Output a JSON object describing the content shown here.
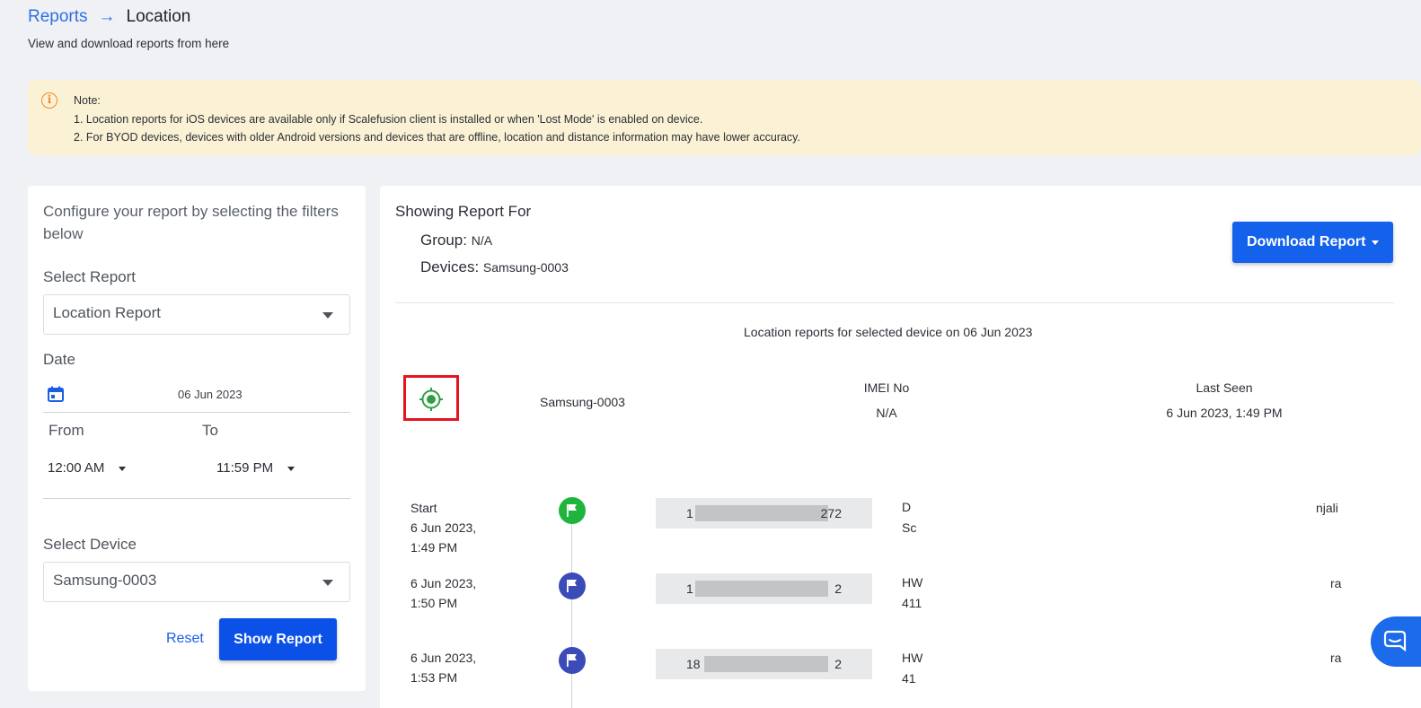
{
  "breadcrumb": {
    "parent": "Reports",
    "current": "Location"
  },
  "subtitle": "View and download reports from here",
  "note": {
    "title": "Note:",
    "line1": "1. Location reports for iOS devices are available only if Scalefusion client is installed or when 'Lost Mode' is enabled on device.",
    "line2": "2. For BYOD devices, devices with older Android versions and devices that are offline, location and distance information may have lower accuracy."
  },
  "filters": {
    "intro": "Configure your report by selecting the filters below",
    "select_report_label": "Select Report",
    "select_report_value": "Location Report",
    "date_label": "Date",
    "date_value": "06 Jun 2023",
    "from_label": "From",
    "to_label": "To",
    "from_value": "12:00 AM",
    "to_value": "11:59 PM",
    "select_device_label": "Select Device",
    "select_device_value": "Samsung-0003",
    "reset_label": "Reset",
    "show_label": "Show Report"
  },
  "report": {
    "showing_title": "Showing Report For",
    "group_label": "Group:",
    "group_value": "N/A",
    "devices_label": "Devices:",
    "devices_value": "Samsung-0003",
    "download_label": "Download Report",
    "caption": "Location reports for selected device on 06 Jun 2023",
    "device_name": "Samsung-0003",
    "imei_label": "IMEI No",
    "imei_value": "N/A",
    "last_seen_label": "Last Seen",
    "last_seen_value": "6 Jun 2023, 1:49 PM"
  },
  "timeline": [
    {
      "label": "Start",
      "date": "6 Jun 2023,",
      "time": "1:49 PM",
      "coord_start": "1",
      "coord_end": "272",
      "addr1": "D",
      "addr2": "Sc",
      "addr_end": "njali",
      "dot_color": "#1fb53d"
    },
    {
      "label": "",
      "date": "6 Jun 2023,",
      "time": "1:50 PM",
      "coord_start": "1",
      "coord_end": "2",
      "addr1": "HW",
      "addr2": "411",
      "addr_end": "ra",
      "dot_color": "#3b4bb8"
    },
    {
      "label": "",
      "date": "6 Jun 2023,",
      "time": "1:53 PM",
      "coord_start": "18",
      "coord_end": "2",
      "addr1": "HW",
      "addr2": "41",
      "addr_end": "ra",
      "dot_color": "#3b4bb8"
    }
  ],
  "colors": {
    "primary": "#0b51e8",
    "link": "#2f6fe4",
    "note_bg": "#fbf1d5",
    "locate_green": "#2ea043",
    "highlight_red": "#e5151f"
  },
  "icons": {
    "info": "info-icon",
    "calendar": "calendar-icon",
    "locate": "crosshair-icon",
    "flag": "flag-icon",
    "chat": "chat-icon"
  }
}
